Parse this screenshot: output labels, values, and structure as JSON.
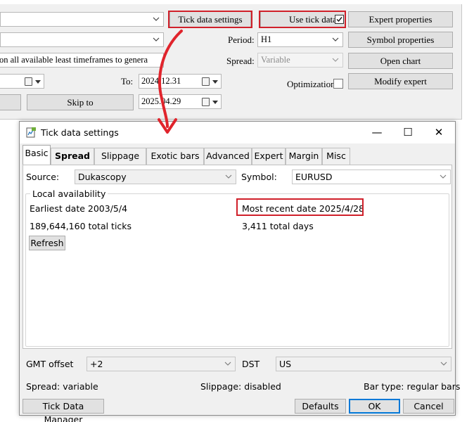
{
  "tester": {
    "tick_data_settings_label": "Tick data settings",
    "use_tick_data_label": "Use tick data",
    "use_tick_data_checked": true,
    "expert_properties_label": "Expert properties",
    "symbol_properties_label": "Symbol properties",
    "open_chart_label": "Open chart",
    "modify_expert_label": "Modify expert",
    "period_label": "Period:",
    "period_value": "H1",
    "spread_label": "Spread:",
    "spread_value": "Variable",
    "model_value": "on all available least timeframes to genera",
    "to_label": "To:",
    "to_value": "2024.12.31",
    "skip_to_value": "2025.04.29",
    "skip_to_label": "Skip to",
    "optimization_label": "Optimization"
  },
  "dialog": {
    "title": "Tick data settings",
    "minimize_glyph": "—",
    "maximize_glyph": "☐",
    "close_glyph": "✕",
    "tabs": [
      {
        "label": "Basic",
        "active": true
      },
      {
        "label": "Spread",
        "active": false
      },
      {
        "label": "Slippage",
        "active": false
      },
      {
        "label": "Exotic bars",
        "active": false
      },
      {
        "label": "Advanced",
        "active": false
      },
      {
        "label": "Expert",
        "active": false
      },
      {
        "label": "Margin",
        "active": false
      },
      {
        "label": "Misc",
        "active": false
      }
    ],
    "source_label": "Source:",
    "source_value": "Dukascopy",
    "symbol_label": "Symbol:",
    "symbol_value": "EURUSD",
    "local_availability_label": "Local availability",
    "earliest_date": "Earliest date 2003/5/4",
    "most_recent_date": "Most recent date 2025/4/28",
    "total_ticks": "189,644,160 total ticks",
    "total_days": "3,411 total days",
    "refresh_label": "Refresh",
    "gmt_offset_label": "GMT offset",
    "gmt_offset_value": "+2",
    "dst_label": "DST",
    "dst_value": "US",
    "spread_status": "Spread: variable",
    "slippage_status": "Slippage: disabled",
    "bar_type_status": "Bar type: regular bars",
    "tick_data_manager_label": "Tick Data Manager",
    "defaults_label": "Defaults",
    "ok_label": "OK",
    "cancel_label": "Cancel"
  },
  "colors": {
    "highlight_red": "#d0202a",
    "arrow_red": "#e0242c",
    "ok_focus_blue": "#0078d7"
  }
}
